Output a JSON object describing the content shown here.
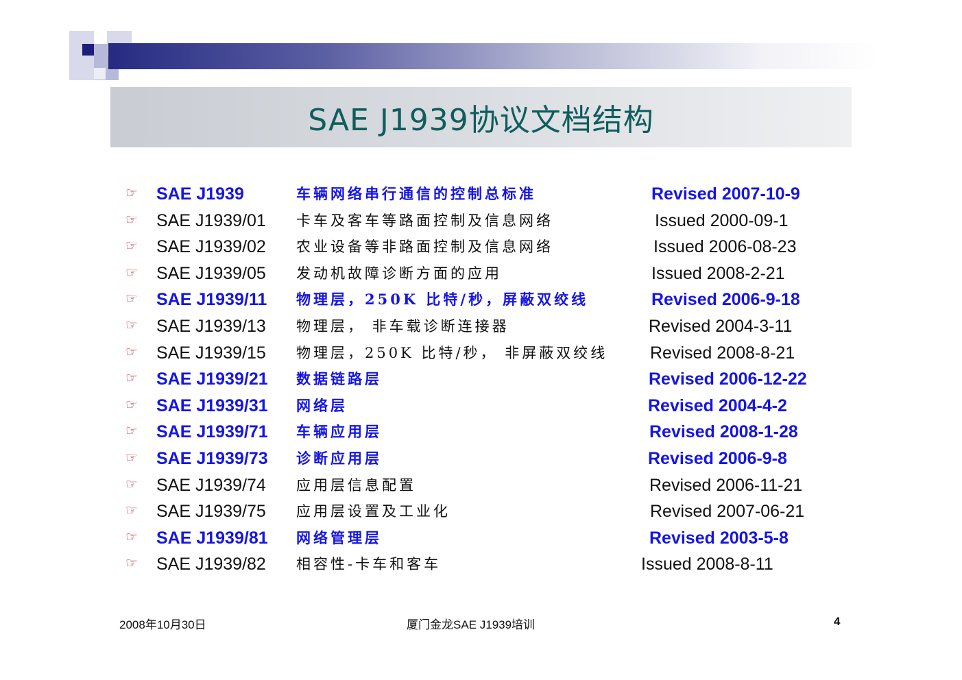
{
  "colors": {
    "highlight": "#1515e6",
    "normal": "#111111",
    "title": "#0f5d5c",
    "bullet": "#c0282a",
    "accent_bar": "#262b82"
  },
  "slide": {
    "title": "SAE J1939协议文档结构"
  },
  "bullet_icon": "☞",
  "documents": [
    {
      "id": "SAE J1939",
      "description": "车辆网络串行通信的控制总标准",
      "date": "Revised 2007-10-9",
      "highlight": true
    },
    {
      "id": "SAE J1939/01",
      "description": "卡车及客车等路面控制及信息网络",
      "date": "Issued 2000-09-1",
      "highlight": false
    },
    {
      "id": "SAE J1939/02",
      "description": "农业设备等非路面控制及信息网络",
      "date": "Issued 2006-08-23",
      "highlight": false
    },
    {
      "id": "SAE J1939/05",
      "description": "发动机故障诊断方面的应用",
      "date": "Issued 2008-2-21",
      "highlight": false
    },
    {
      "id": "SAE J1939/11",
      "description": "物理层，250K 比特/秒，屏蔽双绞线",
      "date": "Revised 2006-9-18",
      "highlight": true
    },
    {
      "id": "SAE J1939/13",
      "description": "物理层， 非车载诊断连接器",
      "date": "Revised 2004-3-11",
      "highlight": false
    },
    {
      "id": "SAE J1939/15",
      "description": "物理层，250K 比特/秒， 非屏蔽双绞线",
      "date": "Revised 2008-8-21",
      "highlight": false
    },
    {
      "id": "SAE J1939/21",
      "description": "数据链路层",
      "date": "Revised 2006-12-22",
      "highlight": true
    },
    {
      "id": "SAE J1939/31",
      "description": "网络层",
      "date": "Revised 2004-4-2",
      "highlight": true
    },
    {
      "id": "SAE J1939/71",
      "description": "车辆应用层",
      "date": "Revised 2008-1-28",
      "highlight": true
    },
    {
      "id": "SAE J1939/73",
      "description": "诊断应用层",
      "date": "Revised 2006-9-8",
      "highlight": true
    },
    {
      "id": "SAE J1939/74",
      "description": "应用层信息配置",
      "date": "Revised 2006-11-21",
      "highlight": false
    },
    {
      "id": "SAE J1939/75",
      "description": "应用层设置及工业化",
      "date": "Revised 2007-06-21",
      "highlight": false
    },
    {
      "id": "SAE J1939/81",
      "description": "网络管理层",
      "date": "Revised 2003-5-8",
      "highlight": true
    },
    {
      "id": "SAE J1939/82",
      "description": "相容性-卡车和客车",
      "date": "Issued 2008-8-11",
      "highlight": false
    }
  ],
  "footer": {
    "date": "2008年10月30日",
    "center": "厦门金龙SAE J1939培训",
    "page_number": "4"
  }
}
